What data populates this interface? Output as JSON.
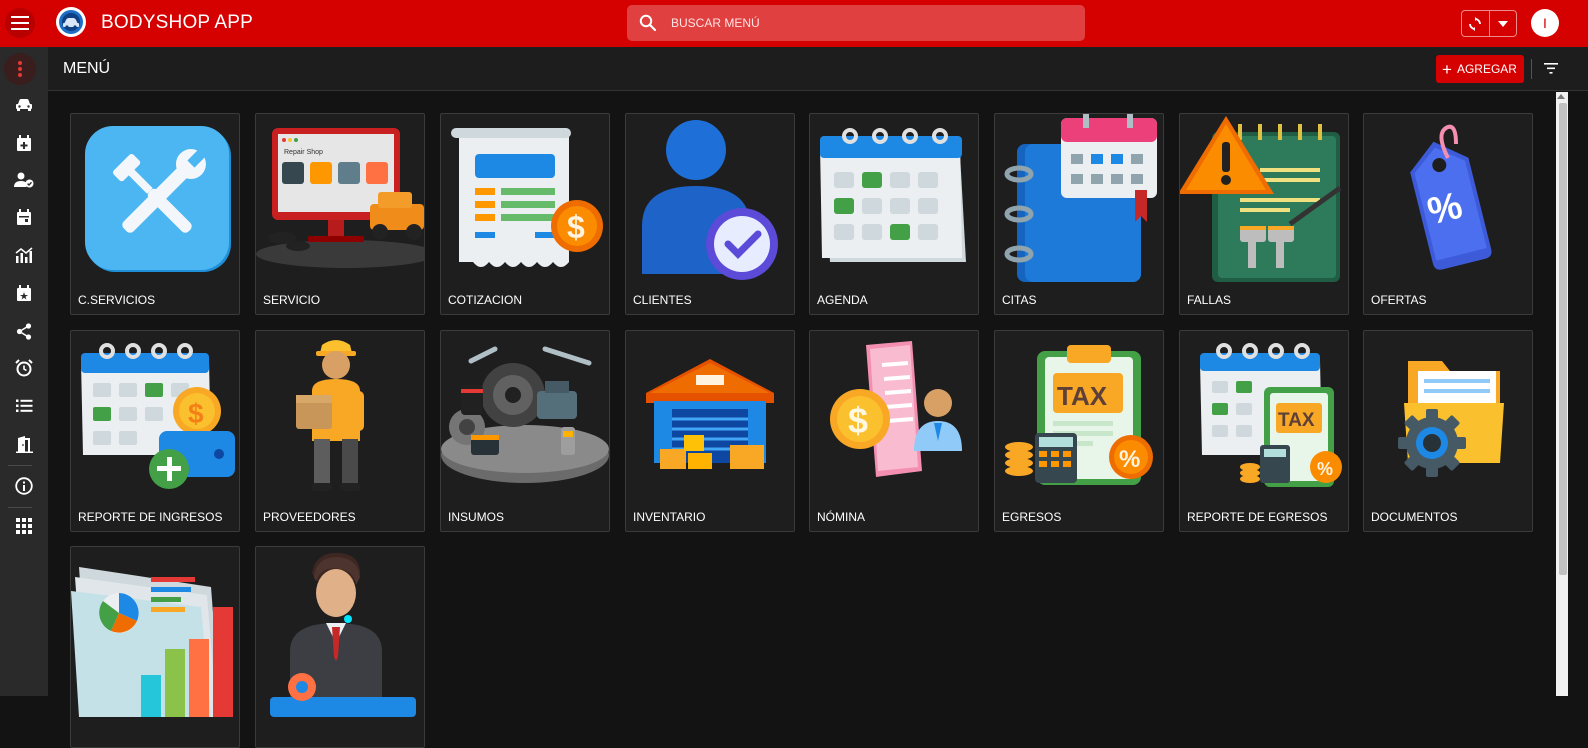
{
  "app": {
    "title": "BODYSHOP APP",
    "avatar_initial": "I"
  },
  "search": {
    "placeholder": "BUSCAR MENÚ"
  },
  "icons": {
    "menu": "hamburger-icon",
    "logo": "car-logo-icon",
    "search": "search-icon",
    "sync": "sync-icon",
    "dropdown": "caret-down-icon",
    "filter": "filter-icon"
  },
  "sidebar": {
    "items": [
      {
        "icon": "more-vert-icon",
        "active": true
      },
      {
        "icon": "car-icon"
      },
      {
        "icon": "calendar-add-icon"
      },
      {
        "icon": "person-check-icon"
      },
      {
        "icon": "calendar-icon"
      },
      {
        "icon": "analytics-icon"
      },
      {
        "icon": "calendar-star-icon"
      },
      {
        "icon": "share-icon"
      },
      {
        "icon": "alarm-icon"
      },
      {
        "icon": "list-icon"
      },
      {
        "icon": "exit-door-icon"
      },
      {
        "icon": "info-icon"
      },
      {
        "icon": "apps-grid-icon"
      }
    ]
  },
  "header": {
    "title": "MENÚ",
    "add_label": "AGREGAR"
  },
  "menu_cards": [
    {
      "label": "C.SERVICIOS",
      "icon": "tools-icon"
    },
    {
      "label": "SERVICIO",
      "icon": "repair-shop-icon"
    },
    {
      "label": "COTIZACION",
      "icon": "quote-invoice-icon"
    },
    {
      "label": "CLIENTES",
      "icon": "client-verified-icon"
    },
    {
      "label": "AGENDA",
      "icon": "agenda-calendar-icon"
    },
    {
      "label": "CITAS",
      "icon": "appointment-book-icon"
    },
    {
      "label": "FALLAS",
      "icon": "failure-warning-icon"
    },
    {
      "label": "OFERTAS",
      "icon": "discount-tag-icon"
    },
    {
      "label": "REPORTE DE INGRESOS",
      "icon": "income-report-icon"
    },
    {
      "label": "PROVEEDORES",
      "icon": "delivery-person-icon"
    },
    {
      "label": "INSUMOS",
      "icon": "car-parts-icon"
    },
    {
      "label": "INVENTARIO",
      "icon": "warehouse-icon"
    },
    {
      "label": "NÓMINA",
      "icon": "payroll-icon"
    },
    {
      "label": "EGRESOS",
      "icon": "tax-clipboard-icon"
    },
    {
      "label": "REPORTE DE EGRESOS",
      "icon": "expense-report-icon"
    },
    {
      "label": "DOCUMENTOS",
      "icon": "documents-folder-icon"
    },
    {
      "label": "",
      "icon": "charts-report-icon"
    },
    {
      "label": "",
      "icon": "manager-user-icon"
    }
  ],
  "colors": {
    "primary": "#d50000",
    "background": "#131313",
    "card": "#1e1e1e",
    "sidebar": "#2a2a2a"
  }
}
